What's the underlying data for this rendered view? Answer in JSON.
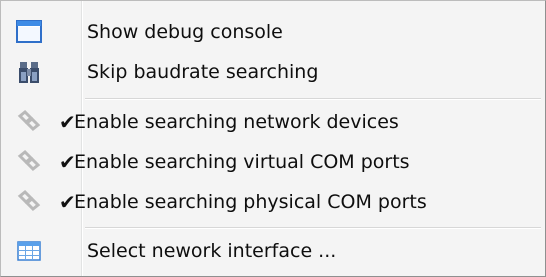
{
  "menu": {
    "items": [
      {
        "label": "Show debug console",
        "icon": "window-icon",
        "checked": false
      },
      {
        "label": "Skip baudrate searching",
        "icon": "binoculars-icon",
        "checked": false
      },
      {
        "label": "Enable searching network devices",
        "icon": "link-icon",
        "checked": true
      },
      {
        "label": "Enable searching virtual COM ports",
        "icon": "link-icon",
        "checked": true
      },
      {
        "label": "Enable searching physical COM ports",
        "icon": "link-icon",
        "checked": true
      },
      {
        "label": "Select nework interface ...",
        "icon": "table-icon",
        "checked": false
      }
    ],
    "check_glyph": "✔"
  }
}
